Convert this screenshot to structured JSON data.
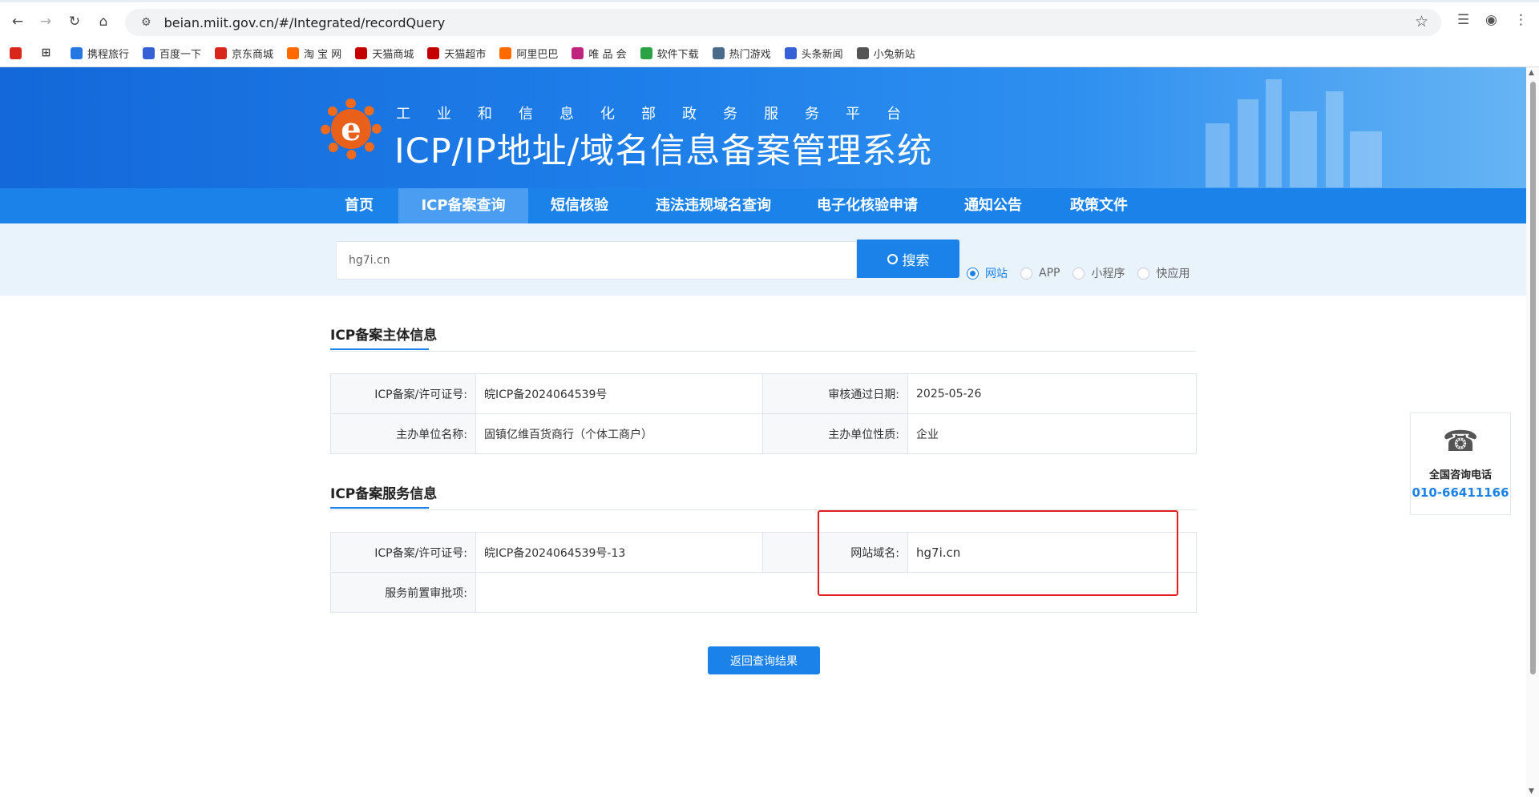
{
  "browser": {
    "url": "beian.miit.gov.cn/#/Integrated/recordQuery",
    "bookmarks": [
      {
        "label": "携程旅行",
        "color": "#2577e3"
      },
      {
        "label": "百度一下",
        "color": "#3660d6"
      },
      {
        "label": "京东商城",
        "color": "#d9261c"
      },
      {
        "label": "淘 宝 网",
        "color": "#ff6a00"
      },
      {
        "label": "天猫商城",
        "color": "#c40000"
      },
      {
        "label": "天猫超市",
        "color": "#c40000"
      },
      {
        "label": "阿里巴巴",
        "color": "#ff6a00"
      },
      {
        "label": "唯 品 会",
        "color": "#c0257e"
      },
      {
        "label": "软件下载",
        "color": "#2ba245"
      },
      {
        "label": "热门游戏",
        "color": "#4a6b8a"
      },
      {
        "label": "头条新闻",
        "color": "#3660d6"
      },
      {
        "label": "小兔新站",
        "color": "#555555"
      }
    ]
  },
  "header": {
    "logo_letter": "e",
    "subtitle": "工业和信息化部政务服务平台",
    "title": "ICP/IP地址/域名信息备案管理系统"
  },
  "menu": [
    {
      "label": "首页",
      "active": false
    },
    {
      "label": "ICP备案查询",
      "active": true
    },
    {
      "label": "短信核验",
      "active": false
    },
    {
      "label": "违法违规域名查询",
      "active": false
    },
    {
      "label": "电子化核验申请",
      "active": false
    },
    {
      "label": "通知公告",
      "active": false
    },
    {
      "label": "政策文件",
      "active": false
    }
  ],
  "search": {
    "value": "hg7i.cn",
    "button": "搜索",
    "types": [
      {
        "label": "网站",
        "checked": true
      },
      {
        "label": "APP",
        "checked": false
      },
      {
        "label": "小程序",
        "checked": false
      },
      {
        "label": "快应用",
        "checked": false
      }
    ]
  },
  "subject": {
    "title": "ICP备案主体信息",
    "license_label": "ICP备案/许可证号:",
    "license_value": "皖ICP备2024064539号",
    "date_label": "审核通过日期:",
    "date_value": "2025-05-26",
    "org_label": "主办单位名称:",
    "org_value": "固镇亿维百货商行（个体工商户）",
    "nature_label": "主办单位性质:",
    "nature_value": "企业"
  },
  "service": {
    "title": "ICP备案服务信息",
    "license_label": "ICP备案/许可证号:",
    "license_value": "皖ICP备2024064539号-13",
    "domain_label": "网站域名:",
    "domain_value": "hg7i.cn",
    "approval_label": "服务前置审批项:",
    "approval_value": ""
  },
  "back_button": "返回查询结果",
  "hotline": {
    "label": "全国咨询电话",
    "number": "010-66411166"
  }
}
